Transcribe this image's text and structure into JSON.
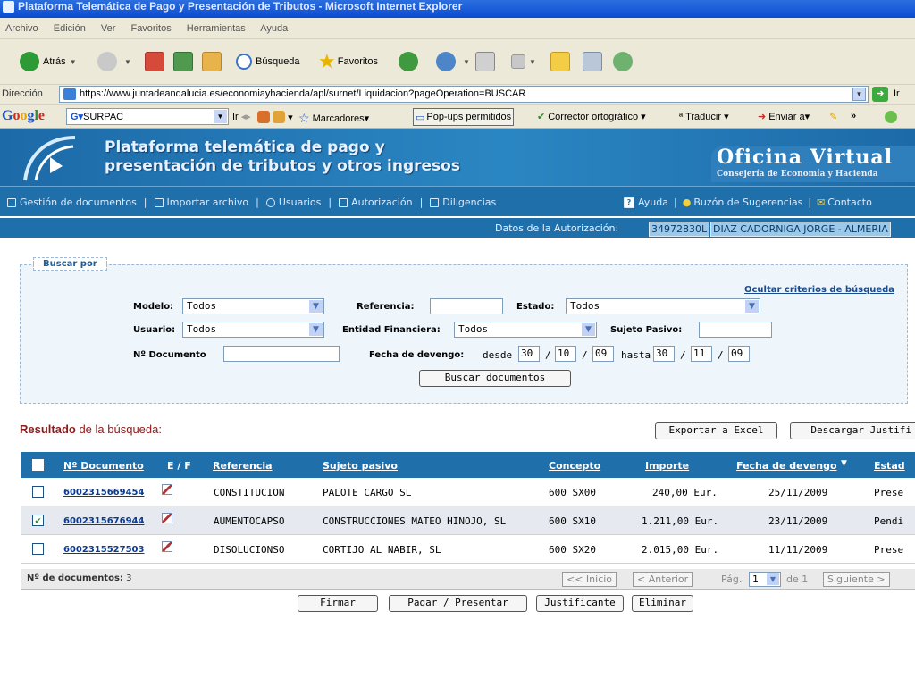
{
  "window": {
    "title": "Plataforma Telemática de Pago y Presentación de Tributos - Microsoft Internet Explorer"
  },
  "menu": [
    "Archivo",
    "Edición",
    "Ver",
    "Favoritos",
    "Herramientas",
    "Ayuda"
  ],
  "toolbar": {
    "back": "Atrás",
    "search": "Búsqueda",
    "favorites": "Favoritos"
  },
  "address": {
    "label": "Dirección",
    "url": "https://www.juntadeandalucia.es/economiayhacienda/apl/surnet/Liquidacion?pageOperation=BUSCAR",
    "go": "Ir"
  },
  "google": {
    "logo": "Google",
    "search_value": "SURPAC",
    "go": "Ir",
    "bookmarks": "Marcadores",
    "popups": "Pop-ups permitidos",
    "spell": "Corrector ortográfico",
    "translate": "Traducir",
    "send": "Enviar a",
    "more": "»"
  },
  "header": {
    "title_line1": "Plataforma telemática de pago y",
    "title_line2": "presentación de tributos y otros ingresos",
    "brand": "Oficina Virtual",
    "brand_sub": "Consejería de Economía y Hacienda"
  },
  "nav": {
    "items": [
      "Gestión de documentos",
      "Importar archivo",
      "Usuarios",
      "Autorización",
      "Diligencias"
    ],
    "right": [
      "Ayuda",
      "Buzón de Sugerencias",
      "Contacto"
    ],
    "separator": "|"
  },
  "auth": {
    "label": "Datos de la Autorización:",
    "nif": "34972830L",
    "name": "DIAZ CADORNIGA JORGE - ALMERIA"
  },
  "search": {
    "legend": "Buscar por",
    "hide_link": "Ocultar criterios de búsqueda",
    "modelo_label": "Modelo:",
    "modelo_value": "Todos",
    "referencia_label": "Referencia:",
    "referencia_value": "",
    "estado_label": "Estado:",
    "estado_value": "Todos",
    "usuario_label": "Usuario:",
    "usuario_value": "Todos",
    "entidad_label": "Entidad Financiera:",
    "entidad_value": "Todos",
    "sujeto_label": "Sujeto Pasivo:",
    "sujeto_value": "",
    "documento_label": "Nº Documento",
    "documento_value": "",
    "fecha_label": "Fecha de devengo:",
    "desde_label": "desde",
    "desde_d": "30",
    "desde_m": "10",
    "desde_y": "09",
    "hasta_label": "hasta",
    "hasta_d": "30",
    "hasta_m": "11",
    "hasta_y": "09",
    "date_sep": "/",
    "button": "Buscar documentos"
  },
  "results": {
    "title_bold": "Resultado",
    "title_rest": " de la búsqueda:",
    "export_button": "Exportar a Excel",
    "download_button": "Descargar Justifi",
    "columns": [
      "Nº Documento",
      "E / F",
      "Referencia",
      "Sujeto pasivo",
      "Concepto",
      "Importe",
      "Fecha de devengo",
      "Estad"
    ],
    "sort_marker": "▼",
    "rows": [
      {
        "checked": false,
        "doc": "6002315669454",
        "ref": "CONSTITUCION",
        "sujeto": "PALOTE CARGO SL",
        "concepto": "600 SX00",
        "importe": "240,00 Eur.",
        "fecha": "25/11/2009",
        "estado": "Prese"
      },
      {
        "checked": true,
        "doc": "6002315676944",
        "ref": "AUMENTOCAPSO",
        "sujeto": "CONSTRUCCIONES MATEO HINOJO, SL",
        "concepto": "600 SX10",
        "importe": "1.211,00 Eur.",
        "fecha": "23/11/2009",
        "estado": "Pendi"
      },
      {
        "checked": false,
        "doc": "6002315527503",
        "ref": "DISOLUCIONSO",
        "sujeto": "CORTIJO AL NABIR, SL",
        "concepto": "600 SX20",
        "importe": "2.015,00 Eur.",
        "fecha": "11/11/2009",
        "estado": "Prese"
      }
    ],
    "count_label": "Nº de documentos:",
    "count_value": "3",
    "pager": {
      "first": "<< Inicio",
      "prev": "< Anterior",
      "page_label": "Pág.",
      "page": "1",
      "of": "de 1",
      "next": "Siguiente >"
    }
  },
  "actions": [
    "Firmar",
    "Pagar / Presentar",
    "Justificante",
    "Eliminar"
  ],
  "colors": {
    "primary": "#1f6fab",
    "result_title": "#8b1b1b",
    "link": "#0b3a8f"
  }
}
